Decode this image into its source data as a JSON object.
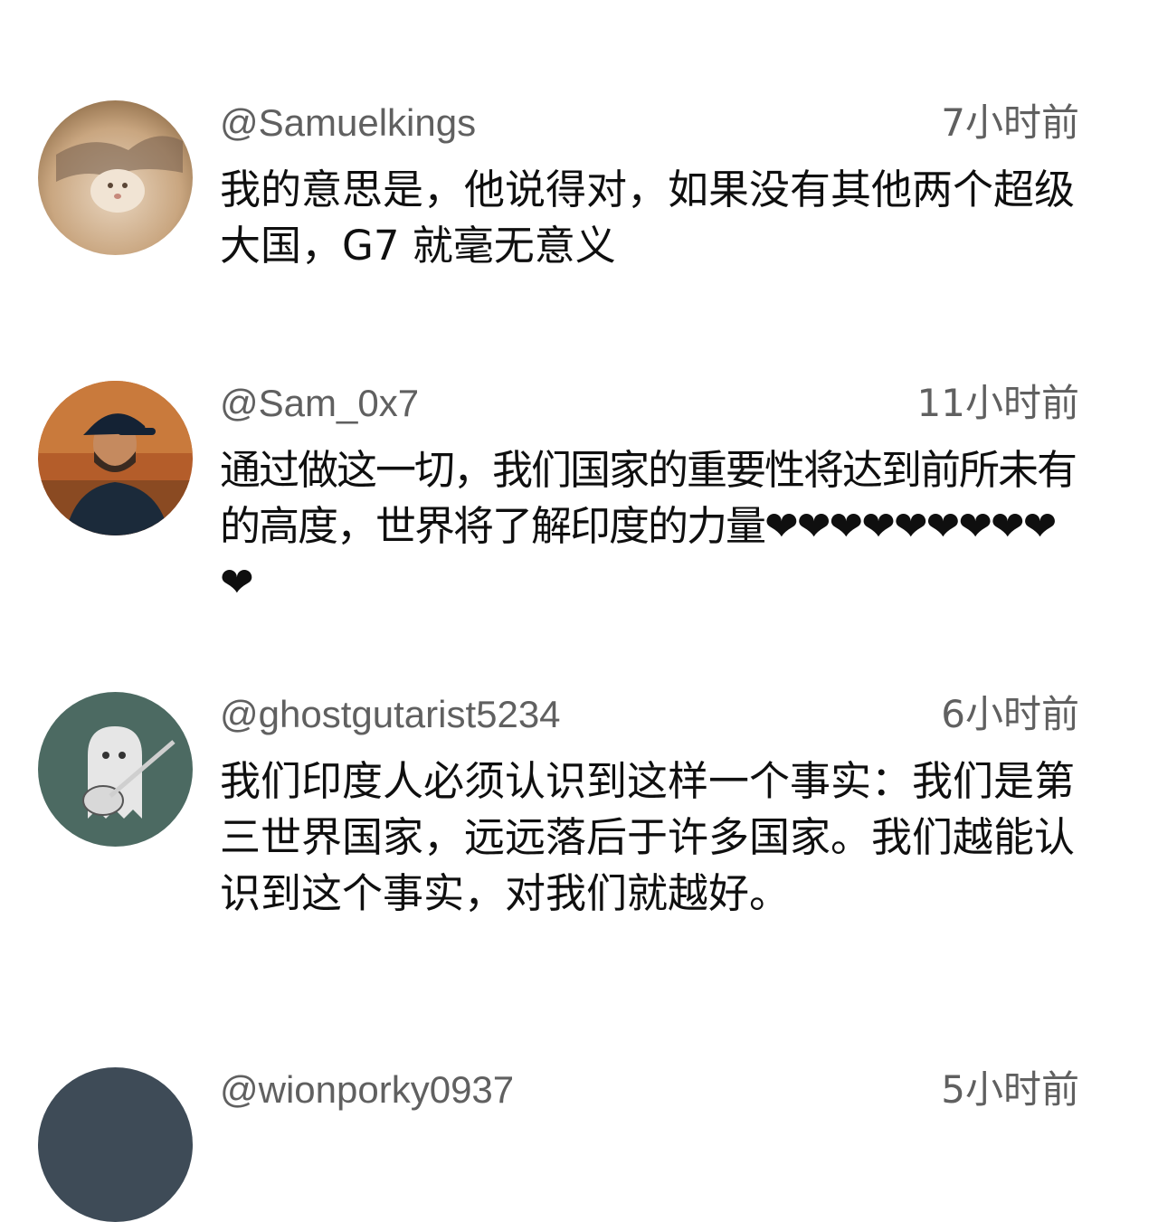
{
  "comments": [
    {
      "author": "@Samuelkings",
      "time": "7小时前",
      "text": "我的意思是，他说得对，如果没有其他两个超级大国，G7 就毫无意义",
      "avatar_icon": "cat-photo-avatar"
    },
    {
      "author": "@Sam_0x7",
      "time": "11小时前",
      "text": "通过做这一切，我们国家的重要性将达到前所未有的高度，世界将了解印度的力量❤❤❤❤❤❤❤❤❤❤",
      "avatar_icon": "man-with-cap-avatar"
    },
    {
      "author": "@ghostgutarist5234",
      "time": "6小时前",
      "text": "我们印度人必须认识到这样一个事实：我们是第三世界国家，远远落后于许多国家。我们越能认识到这个事实，对我们就越好。",
      "avatar_icon": "ghost-guitar-avatar"
    },
    {
      "author": "@wionporky0937",
      "time": "5小时前",
      "avatar_icon": "partial-avatar"
    }
  ],
  "colors": {
    "background": "#ffffff",
    "secondary_text": "#606060",
    "primary_text": "#0f0f0f"
  }
}
